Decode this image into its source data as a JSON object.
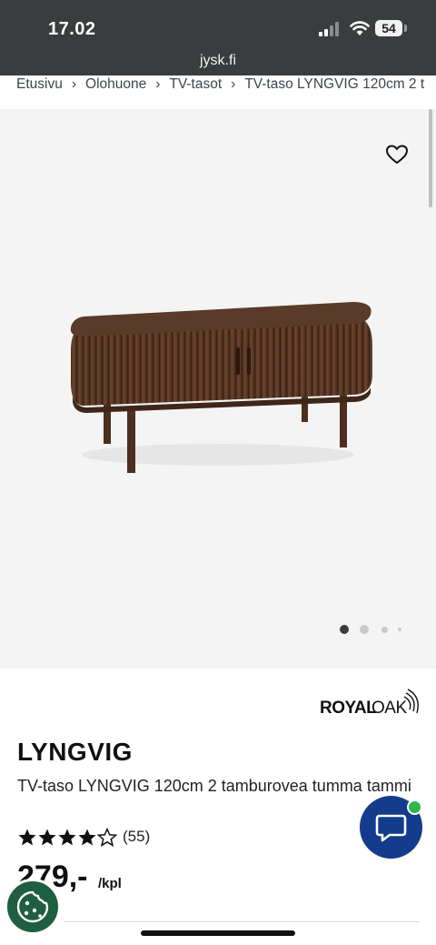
{
  "status_bar": {
    "time": "17.02",
    "battery": "54",
    "url": "jysk.fi"
  },
  "breadcrumb": [
    "Etusivu",
    "Olohuone",
    "TV-tasot",
    "TV-taso LYNGVIG 120cm 2 t"
  ],
  "gallery": {
    "image_count": 4,
    "active_index": 0
  },
  "brand": {
    "logo_text": "ROYALOAK"
  },
  "product": {
    "name": "LYNGVIG",
    "description": "TV-taso LYNGVIG 120cm 2 tamburovea tumma tammi",
    "rating": 4.5,
    "review_count": "(55)",
    "price": "279,-",
    "unit": "/kpl"
  },
  "colors": {
    "status_bar": "#3a3d3e",
    "chat_button": "#143c8c",
    "online": "#2fb54a",
    "cookie": "#1f5e3e",
    "wood": "#5c3a26"
  }
}
